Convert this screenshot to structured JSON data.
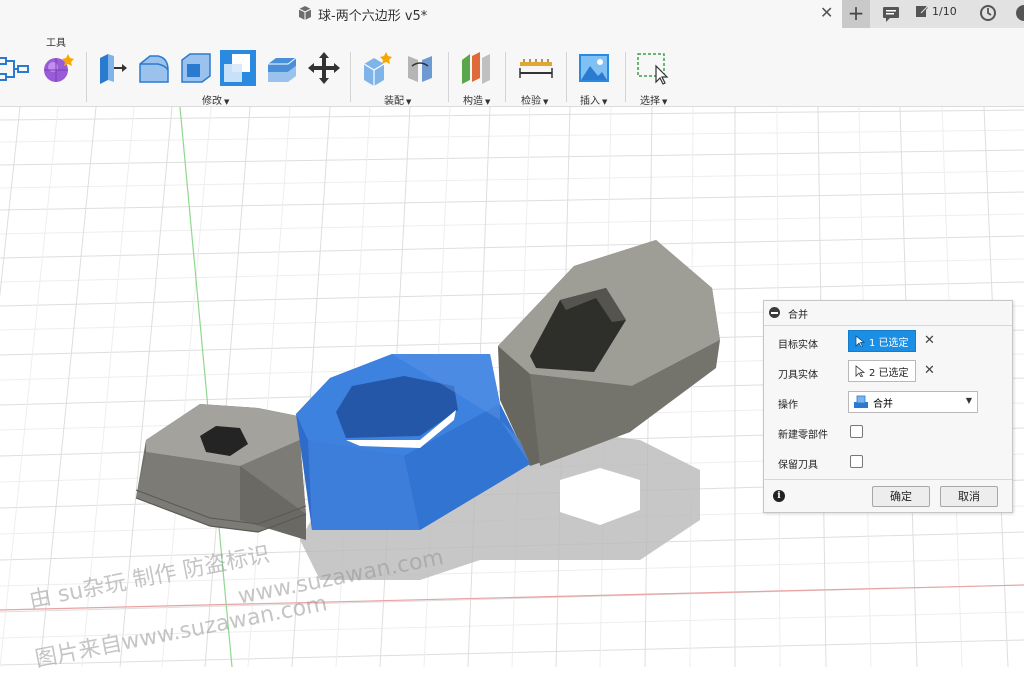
{
  "titlebar": {
    "doc_title": "球-两个六边形 v5*",
    "close": "✕",
    "add": "+",
    "jobs": "1/10"
  },
  "ribbon": {
    "tools_label": "工具",
    "groups": {
      "modify": "修改",
      "assemble": "装配",
      "construct": "构造",
      "inspect": "检验",
      "insert": "插入",
      "select": "选择"
    },
    "icons": [
      "sketch-icon",
      "make-icon",
      "press-pull-icon",
      "fillet-icon",
      "shell-icon",
      "combine-icon",
      "scale-icon",
      "move-icon",
      "new-component-icon",
      "joint-icon",
      "plane-icon",
      "measure-icon",
      "insert-image-icon",
      "select-icon"
    ]
  },
  "panel": {
    "title": "合并",
    "target_label": "目标实体",
    "target_value": "1 已选定",
    "tool_label": "刀具实体",
    "tool_value": "2 已选定",
    "op_label": "操作",
    "op_value": "合并",
    "new_component_label": "新建零部件",
    "keep_tools_label": "保留刀具",
    "new_component_checked": false,
    "keep_tools_checked": false,
    "ok": "确定",
    "cancel": "取消"
  },
  "watermark": {
    "line1": "由 su杂玩 制作 防盗标识",
    "line2": "www.suzawan.com",
    "line3": "图片来自www.suzawan.com"
  },
  "colors": {
    "accent": "#1c8ee3",
    "selected_body": "#3a7bd5",
    "body": "#7a7a76",
    "grid": "#dcdcdc"
  }
}
